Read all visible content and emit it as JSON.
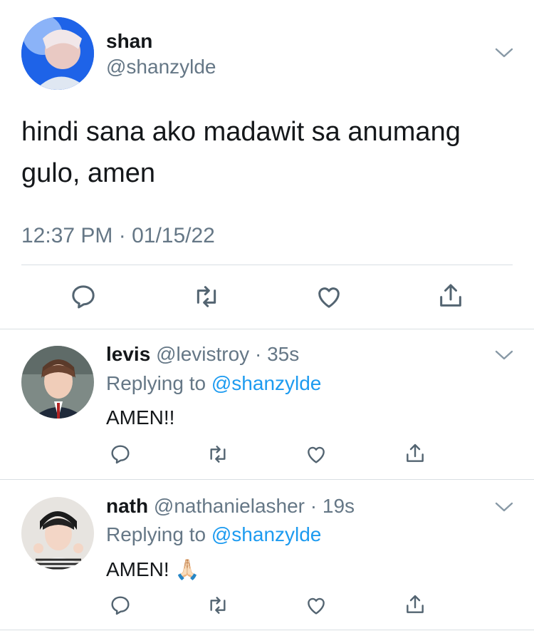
{
  "main_tweet": {
    "author": {
      "name": "shan",
      "handle": "@shanzylde"
    },
    "text_line1": "hindi sana ako madawit sa anumang",
    "text_line2": "gulo, amen",
    "timestamp": "12:37 PM · 01/15/22",
    "actions": [
      "reply-icon",
      "retweet-icon",
      "like-icon",
      "share-icon"
    ]
  },
  "replies": [
    {
      "name": "levis",
      "handle": "@levistroy",
      "time": "· 35s",
      "replying_prefix": "Replying to",
      "replying_to": "@shanzylde",
      "text": "AMEN!!"
    },
    {
      "name": "nath",
      "handle": "@nathanielasher",
      "time": "· 19s",
      "replying_prefix": "Replying to",
      "replying_to": "@shanzylde",
      "text": "AMEN!",
      "emoji": "🙏🏻"
    }
  ],
  "colors": {
    "accent": "#1d9bf0",
    "secondary_text": "#657786",
    "divider": "#d9dfe3",
    "icon": "#536471"
  }
}
